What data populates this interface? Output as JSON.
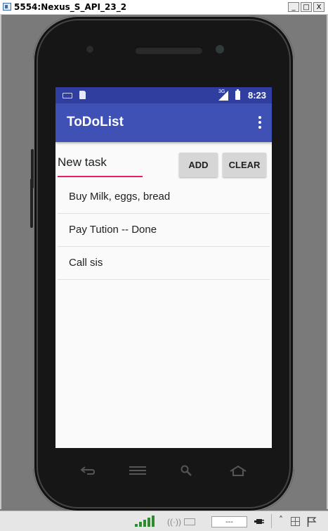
{
  "window": {
    "title": "5554:Nexus_S_API_23_2",
    "min_label": "_",
    "max_label": "□",
    "close_label": "X"
  },
  "status_bar": {
    "network": "3G",
    "time": "8:23"
  },
  "app": {
    "title": "ToDoList"
  },
  "input": {
    "value": "New task"
  },
  "buttons": {
    "add": "ADD",
    "clear": "CLEAR"
  },
  "tasks": [
    "Buy Milk, eggs, bread",
    "Pay Tution -- Done",
    "Call sis"
  ],
  "taskbar": {
    "field_text": "---"
  },
  "icons": {
    "window": "emulator-window-icon",
    "overflow": "more-vert-icon",
    "back": "back-icon",
    "menu": "menu-icon",
    "search": "search-icon",
    "home": "home-icon"
  },
  "colors": {
    "status_bar": "#303f9f",
    "app_bar": "#3f51b5",
    "accent": "#e91e63"
  }
}
